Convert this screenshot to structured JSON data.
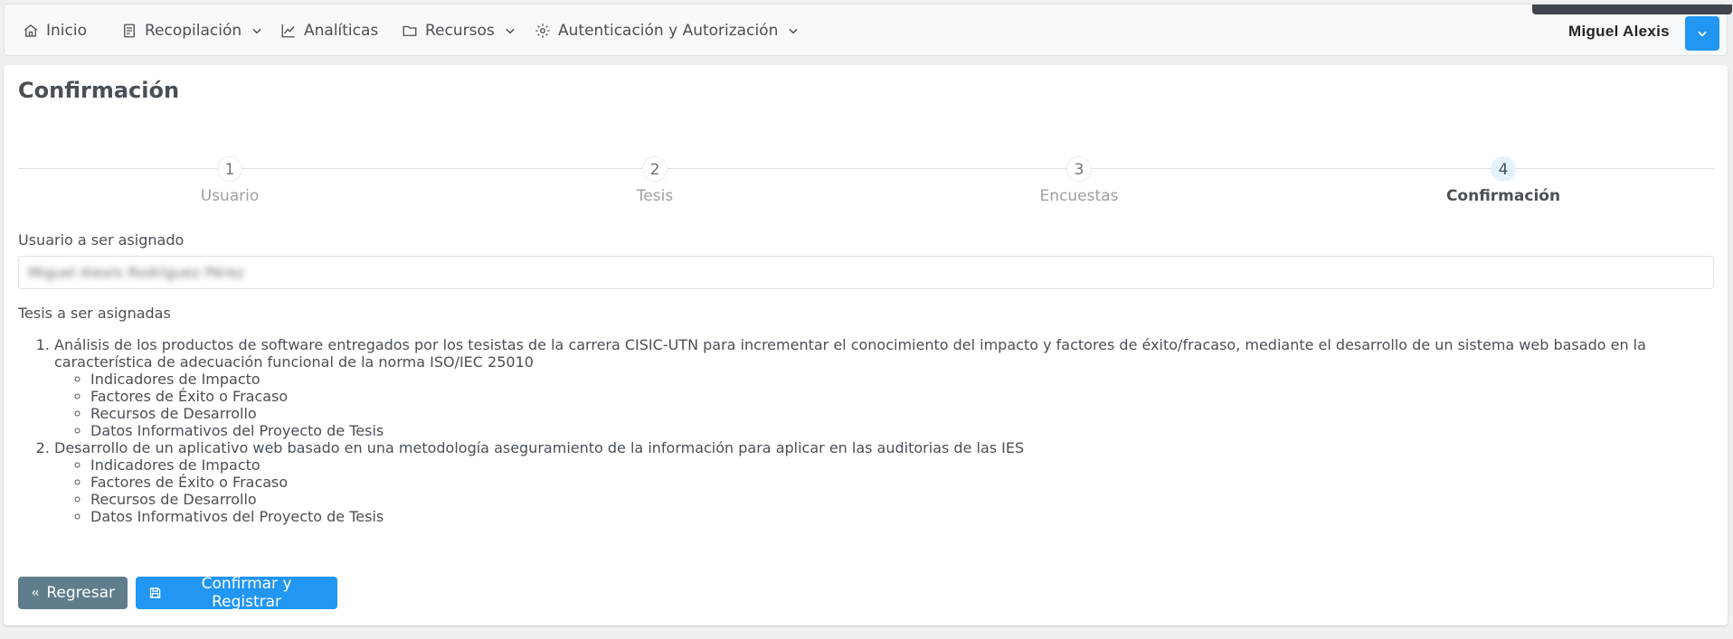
{
  "menubar": {
    "items": [
      {
        "label": "Inicio",
        "icon": "home-icon"
      },
      {
        "label": "Recopilación",
        "icon": "document-icon",
        "has_dropdown": true
      },
      {
        "label": "Analíticas",
        "icon": "chart-line-icon"
      },
      {
        "label": "Recursos",
        "icon": "folder-icon",
        "has_dropdown": true
      },
      {
        "label": "Autenticación y Autorización",
        "icon": "gear-icon",
        "has_dropdown": true
      }
    ],
    "user_name": "Miguel Alexis",
    "user_menu_icon": "chevron-down-icon"
  },
  "page": {
    "title": "Confirmación"
  },
  "steps": [
    {
      "number": "1",
      "label": "Usuario",
      "active": false
    },
    {
      "number": "2",
      "label": "Tesis",
      "active": false
    },
    {
      "number": "3",
      "label": "Encuestas",
      "active": false
    },
    {
      "number": "4",
      "label": "Confirmación",
      "active": true
    }
  ],
  "form": {
    "user_label": "Usuario a ser asignado",
    "user_value": "Miguel Alexis Rodríguez Pérez",
    "thesis_label": "Tesis a ser asignadas"
  },
  "theses": [
    {
      "title": "Análisis de los productos de software entregados por los tesistas de la carrera CISIC-UTN para incrementar el conocimiento del impacto y factores de éxito/fracaso, mediante el desarrollo de un sistema web basado en la característica de adecuación funcional de la norma ISO/IEC 25010",
      "surveys": [
        "Indicadores de Impacto",
        "Factores de Éxito o Fracaso",
        "Recursos de Desarrollo",
        "Datos Informativos del Proyecto de Tesis"
      ]
    },
    {
      "title": "Desarrollo de un aplicativo web basado en una metodología aseguramiento de la información para aplicar en las auditorias de las IES",
      "surveys": [
        "Indicadores de Impacto",
        "Factores de Éxito o Fracaso",
        "Recursos de Desarrollo",
        "Datos Informativos del Proyecto de Tesis"
      ]
    }
  ],
  "buttons": {
    "back_label": "Regresar",
    "back_icon": "double-chevron-left-icon",
    "confirm_label": "Confirmar y Registrar",
    "confirm_icon": "save-icon"
  },
  "colors": {
    "primary": "#2196f3",
    "secondary": "#607d8b",
    "text": "#495057",
    "step_active_bg": "#e3f2fd"
  }
}
